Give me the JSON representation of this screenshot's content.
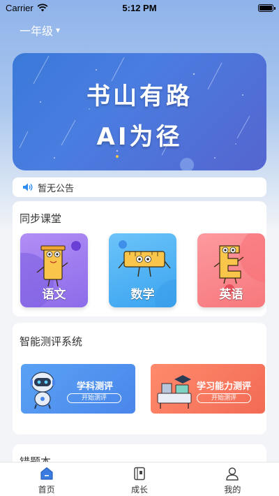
{
  "status_bar": {
    "carrier": "Carrier",
    "time": "5:12 PM"
  },
  "grade_selector": {
    "label": "一年级",
    "caret": "▾"
  },
  "banner": {
    "line1": "书山有路",
    "line2": "AI为径"
  },
  "notice": {
    "text": "暂无公告",
    "icon": "speaker-icon"
  },
  "sync_class": {
    "title": "同步课堂",
    "subjects": [
      {
        "label": "语文",
        "color": "#9b7bf0"
      },
      {
        "label": "数学",
        "color": "#4fb2f5"
      },
      {
        "label": "英语",
        "color": "#f8868b"
      }
    ]
  },
  "evaluation": {
    "title": "智能测评系统",
    "items": [
      {
        "name": "学科测评",
        "action": "开始测评",
        "color": "#4f90ee"
      },
      {
        "name": "学习能力测评",
        "action": "开始测评",
        "color": "#f57a5f"
      }
    ]
  },
  "wrong_book": {
    "title": "错题本"
  },
  "tabbar": {
    "items": [
      {
        "label": "首页",
        "icon": "home-icon",
        "active": true
      },
      {
        "label": "成长",
        "icon": "growth-icon",
        "active": false
      },
      {
        "label": "我的",
        "icon": "profile-icon",
        "active": false
      }
    ]
  },
  "colors": {
    "accent": "#3a7be0",
    "background": "#f2f4f7"
  }
}
